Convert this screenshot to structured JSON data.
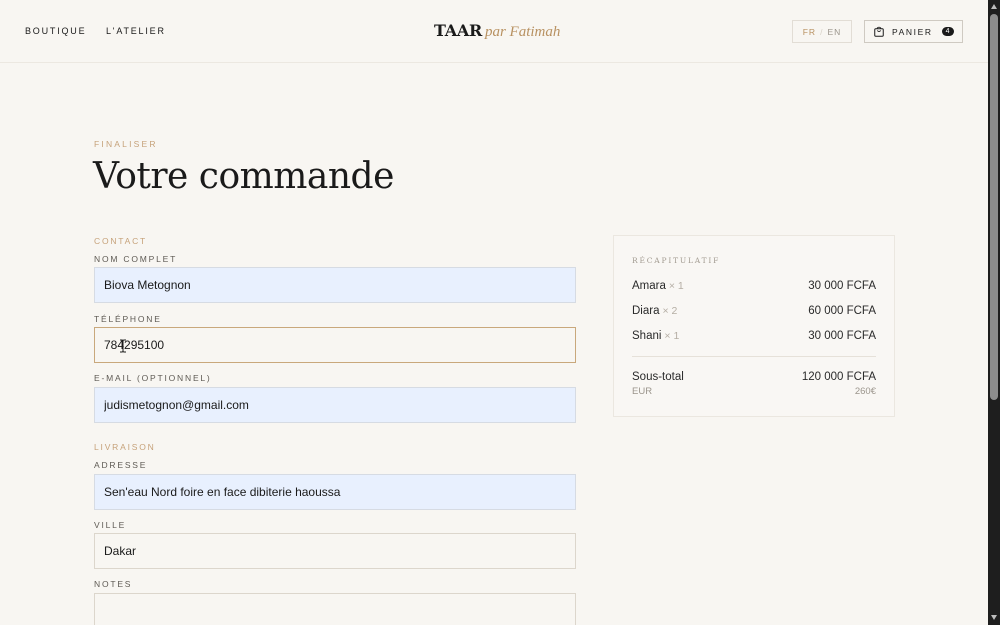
{
  "nav": {
    "boutique": "BOUTIQUE",
    "atelier": "L'ATELIER"
  },
  "logo": {
    "main": "TAAR",
    "sub": "par Fatimah"
  },
  "lang": {
    "fr": "FR",
    "sep": "/",
    "en": "EN",
    "active": "FR"
  },
  "cart": {
    "label": "PANIER",
    "count": "4",
    "icon": "shopping-bag-icon"
  },
  "heading": {
    "eyebrow": "FINALISER",
    "title": "Votre commande"
  },
  "form": {
    "contact_section": "CONTACT",
    "name_label": "NOM COMPLET",
    "name_value": "Biova Metognon",
    "phone_label": "TÉLÉPHONE",
    "phone_value": "784295100",
    "email_label": "E-MAIL (OPTIONNEL)",
    "email_value": "judismetognon@gmail.com",
    "delivery_section": "LIVRAISON",
    "address_label": "ADRESSE",
    "address_value": "Sen'eau Nord foire en face dibiterie haoussa",
    "city_label": "VILLE",
    "city_value": "Dakar",
    "notes_label": "NOTES",
    "notes_value": ""
  },
  "summary": {
    "title": "RÉCAPITULATIF",
    "items": [
      {
        "name": "Amara",
        "qty": "× 1",
        "price": "30 000 FCFA"
      },
      {
        "name": "Diara",
        "qty": "× 2",
        "price": "60 000 FCFA"
      },
      {
        "name": "Shani",
        "qty": "× 1",
        "price": "30 000 FCFA"
      }
    ],
    "subtotal_label": "Sous-total",
    "subtotal_value": "120 000 FCFA",
    "eur_label": "EUR",
    "eur_value": "260€"
  },
  "colors": {
    "background": "#f8f6f2",
    "accent_gold": "#c6a27a",
    "text_dark": "#1a1a1a",
    "autofill_blue": "#e8f0fe"
  }
}
